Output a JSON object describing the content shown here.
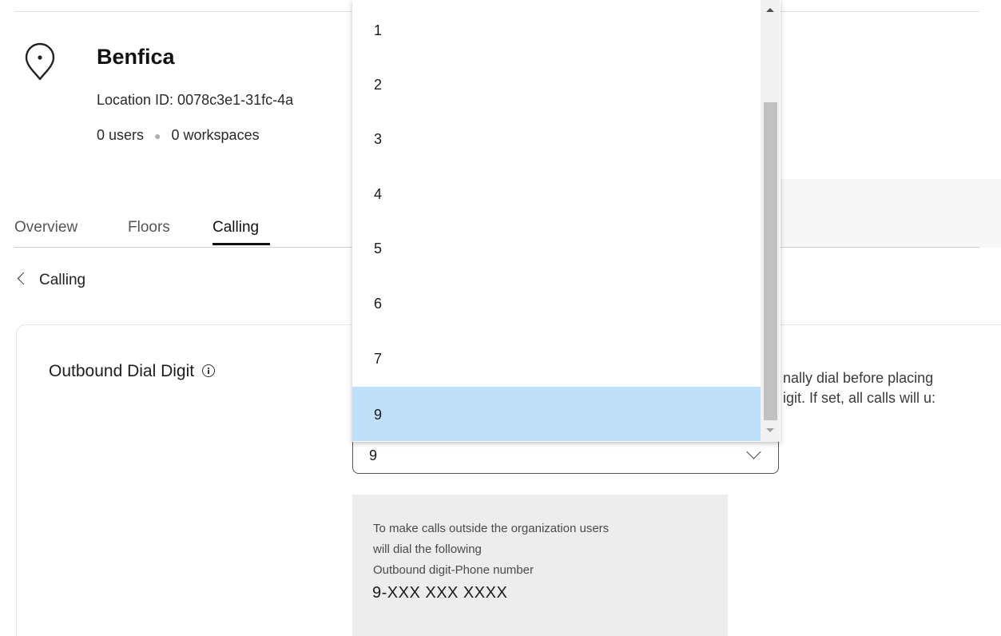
{
  "location": {
    "name": "Benfica",
    "id_label": "Location ID: 0078c3e1-31fc-4a",
    "users_count": "0 users",
    "workspaces_count": "0 workspaces"
  },
  "tabs": [
    {
      "label": "Overview",
      "active": false
    },
    {
      "label": "Floors",
      "active": false
    },
    {
      "label": "Calling",
      "active": true
    }
  ],
  "back_link": {
    "label": "Calling"
  },
  "field": {
    "label": "Outbound Dial Digit",
    "description_lines": [
      "nally dial before placing",
      "igit. If set, all calls will u:"
    ],
    "selected_value": "9"
  },
  "dropdown": {
    "options": [
      "1",
      "2",
      "3",
      "4",
      "5",
      "6",
      "7",
      "9"
    ],
    "highlighted": "9"
  },
  "info_box": {
    "line1": "To make calls outside the organization users",
    "line2": "will dial the following",
    "line3": "Outbound digit-Phone number",
    "example": "9-XXX XXX XXXX"
  },
  "colors": {
    "highlight": "#c0e0fa",
    "active_tab_underline": "#121212",
    "info_box_bg": "#ededed"
  }
}
